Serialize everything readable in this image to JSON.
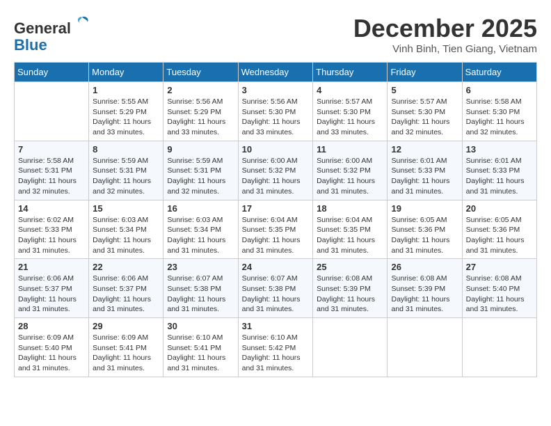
{
  "header": {
    "logo_line1": "General",
    "logo_line2": "Blue",
    "month_title": "December 2025",
    "subtitle": "Vinh Binh, Tien Giang, Vietnam"
  },
  "weekdays": [
    "Sunday",
    "Monday",
    "Tuesday",
    "Wednesday",
    "Thursday",
    "Friday",
    "Saturday"
  ],
  "weeks": [
    [
      {
        "day": "",
        "info": ""
      },
      {
        "day": "1",
        "info": "Sunrise: 5:55 AM\nSunset: 5:29 PM\nDaylight: 11 hours\nand 33 minutes."
      },
      {
        "day": "2",
        "info": "Sunrise: 5:56 AM\nSunset: 5:29 PM\nDaylight: 11 hours\nand 33 minutes."
      },
      {
        "day": "3",
        "info": "Sunrise: 5:56 AM\nSunset: 5:30 PM\nDaylight: 11 hours\nand 33 minutes."
      },
      {
        "day": "4",
        "info": "Sunrise: 5:57 AM\nSunset: 5:30 PM\nDaylight: 11 hours\nand 33 minutes."
      },
      {
        "day": "5",
        "info": "Sunrise: 5:57 AM\nSunset: 5:30 PM\nDaylight: 11 hours\nand 32 minutes."
      },
      {
        "day": "6",
        "info": "Sunrise: 5:58 AM\nSunset: 5:30 PM\nDaylight: 11 hours\nand 32 minutes."
      }
    ],
    [
      {
        "day": "7",
        "info": "Sunrise: 5:58 AM\nSunset: 5:31 PM\nDaylight: 11 hours\nand 32 minutes."
      },
      {
        "day": "8",
        "info": "Sunrise: 5:59 AM\nSunset: 5:31 PM\nDaylight: 11 hours\nand 32 minutes."
      },
      {
        "day": "9",
        "info": "Sunrise: 5:59 AM\nSunset: 5:31 PM\nDaylight: 11 hours\nand 32 minutes."
      },
      {
        "day": "10",
        "info": "Sunrise: 6:00 AM\nSunset: 5:32 PM\nDaylight: 11 hours\nand 31 minutes."
      },
      {
        "day": "11",
        "info": "Sunrise: 6:00 AM\nSunset: 5:32 PM\nDaylight: 11 hours\nand 31 minutes."
      },
      {
        "day": "12",
        "info": "Sunrise: 6:01 AM\nSunset: 5:33 PM\nDaylight: 11 hours\nand 31 minutes."
      },
      {
        "day": "13",
        "info": "Sunrise: 6:01 AM\nSunset: 5:33 PM\nDaylight: 11 hours\nand 31 minutes."
      }
    ],
    [
      {
        "day": "14",
        "info": "Sunrise: 6:02 AM\nSunset: 5:33 PM\nDaylight: 11 hours\nand 31 minutes."
      },
      {
        "day": "15",
        "info": "Sunrise: 6:03 AM\nSunset: 5:34 PM\nDaylight: 11 hours\nand 31 minutes."
      },
      {
        "day": "16",
        "info": "Sunrise: 6:03 AM\nSunset: 5:34 PM\nDaylight: 11 hours\nand 31 minutes."
      },
      {
        "day": "17",
        "info": "Sunrise: 6:04 AM\nSunset: 5:35 PM\nDaylight: 11 hours\nand 31 minutes."
      },
      {
        "day": "18",
        "info": "Sunrise: 6:04 AM\nSunset: 5:35 PM\nDaylight: 11 hours\nand 31 minutes."
      },
      {
        "day": "19",
        "info": "Sunrise: 6:05 AM\nSunset: 5:36 PM\nDaylight: 11 hours\nand 31 minutes."
      },
      {
        "day": "20",
        "info": "Sunrise: 6:05 AM\nSunset: 5:36 PM\nDaylight: 11 hours\nand 31 minutes."
      }
    ],
    [
      {
        "day": "21",
        "info": "Sunrise: 6:06 AM\nSunset: 5:37 PM\nDaylight: 11 hours\nand 31 minutes."
      },
      {
        "day": "22",
        "info": "Sunrise: 6:06 AM\nSunset: 5:37 PM\nDaylight: 11 hours\nand 31 minutes."
      },
      {
        "day": "23",
        "info": "Sunrise: 6:07 AM\nSunset: 5:38 PM\nDaylight: 11 hours\nand 31 minutes."
      },
      {
        "day": "24",
        "info": "Sunrise: 6:07 AM\nSunset: 5:38 PM\nDaylight: 11 hours\nand 31 minutes."
      },
      {
        "day": "25",
        "info": "Sunrise: 6:08 AM\nSunset: 5:39 PM\nDaylight: 11 hours\nand 31 minutes."
      },
      {
        "day": "26",
        "info": "Sunrise: 6:08 AM\nSunset: 5:39 PM\nDaylight: 11 hours\nand 31 minutes."
      },
      {
        "day": "27",
        "info": "Sunrise: 6:08 AM\nSunset: 5:40 PM\nDaylight: 11 hours\nand 31 minutes."
      }
    ],
    [
      {
        "day": "28",
        "info": "Sunrise: 6:09 AM\nSunset: 5:40 PM\nDaylight: 11 hours\nand 31 minutes."
      },
      {
        "day": "29",
        "info": "Sunrise: 6:09 AM\nSunset: 5:41 PM\nDaylight: 11 hours\nand 31 minutes."
      },
      {
        "day": "30",
        "info": "Sunrise: 6:10 AM\nSunset: 5:41 PM\nDaylight: 11 hours\nand 31 minutes."
      },
      {
        "day": "31",
        "info": "Sunrise: 6:10 AM\nSunset: 5:42 PM\nDaylight: 11 hours\nand 31 minutes."
      },
      {
        "day": "",
        "info": ""
      },
      {
        "day": "",
        "info": ""
      },
      {
        "day": "",
        "info": ""
      }
    ]
  ]
}
